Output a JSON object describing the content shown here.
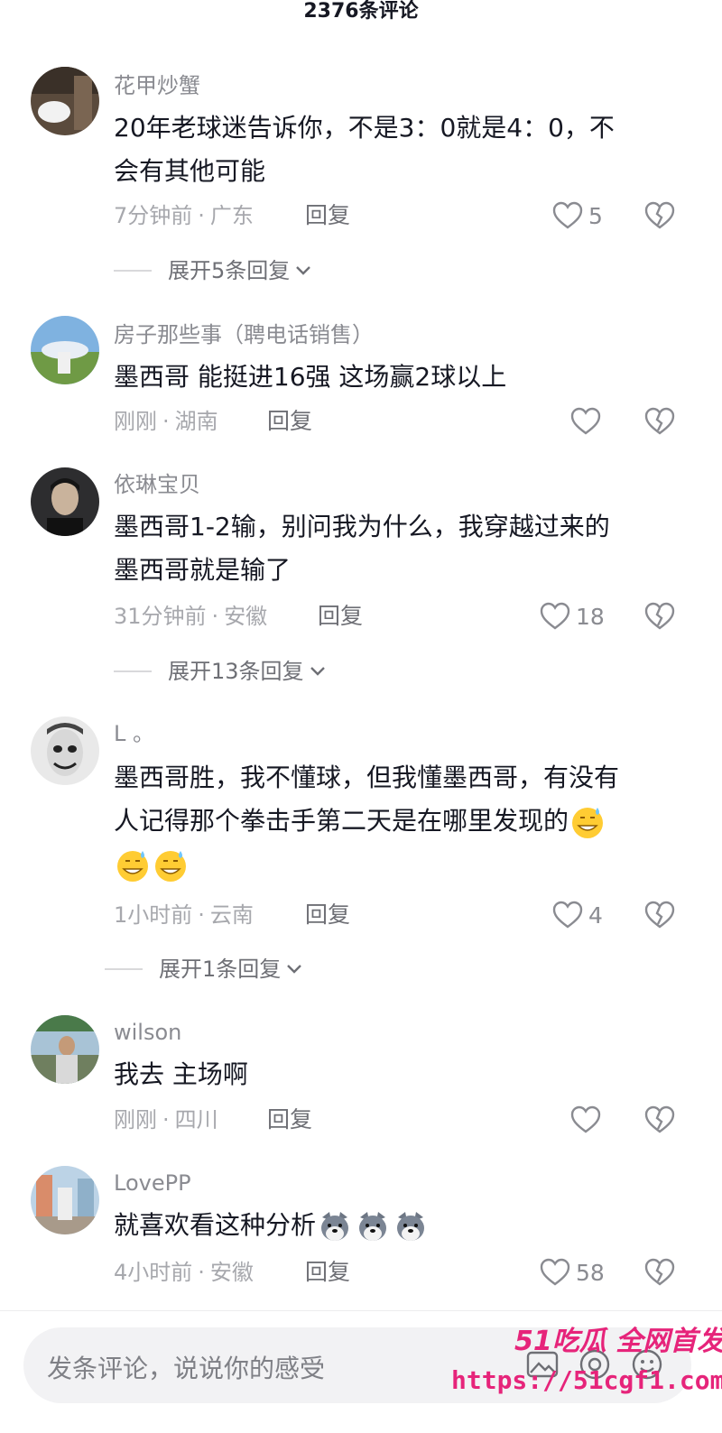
{
  "header": {
    "title": "2376条评论"
  },
  "comments": [
    {
      "user": "花甲炒蟹",
      "text_lines": [
        "20年老球迷告诉你，不是3：0就是4：0，不",
        "会有其他可能"
      ],
      "time": "7分钟前",
      "location": "广东",
      "reply_label": "回复",
      "likes": "5",
      "expand": "展开5条回复"
    },
    {
      "user": "房子那些事（聘电话销售）",
      "text_lines": [
        "墨西哥 能挺进16强  这场赢2球以上"
      ],
      "time": "刚刚",
      "location": "湖南",
      "reply_label": "回复",
      "likes": ""
    },
    {
      "user": "依琳宝贝",
      "text_lines": [
        "墨西哥1-2输，别问我为什么，我穿越过来的",
        "墨西哥就是输了"
      ],
      "time": "31分钟前",
      "location": "安徽",
      "reply_label": "回复",
      "likes": "18",
      "expand": "展开13条回复"
    },
    {
      "user": "L 。",
      "text_lines": [
        "墨西哥胜，我不懂球，但我懂墨西哥，有没有",
        "人记得那个拳击手第二天是在哪里发现的"
      ],
      "time": "1小时前",
      "location": "云南",
      "reply_label": "回复",
      "likes": "4",
      "expand": "展开1条回复"
    },
    {
      "user": "wilson",
      "text_lines": [
        "我去 主场啊"
      ],
      "time": "刚刚",
      "location": "四川",
      "reply_label": "回复",
      "likes": ""
    },
    {
      "user": "LovePP",
      "text_lines": [
        "就喜欢看这种分析"
      ],
      "time": "4小时前",
      "location": "安徽",
      "reply_label": "回复",
      "likes": "58"
    }
  ],
  "footer": {
    "placeholder": "发条评论，说说你的感受"
  },
  "watermark": {
    "brand": "51吃瓜 全网首发",
    "url": "https://51cgf1.com"
  },
  "colors": {
    "accent": "#e6247a",
    "meta": "#a7a8ad",
    "text": "#161823"
  }
}
